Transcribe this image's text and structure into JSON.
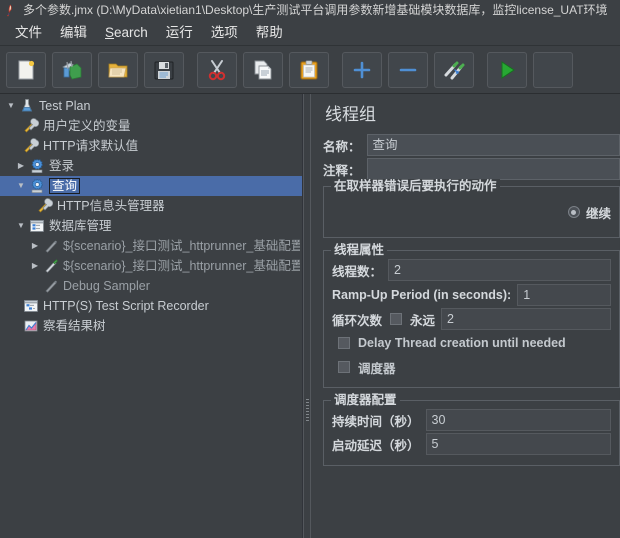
{
  "window": {
    "title": "多个参数.jmx (D:\\MyData\\xietian1\\Desktop\\生产测试平台调用参数新增基础模块数据库，监控license_UAT环境",
    "icon": "jmeter-feather-icon"
  },
  "menubar": {
    "items": [
      {
        "label": "文件",
        "name": "menu-file"
      },
      {
        "label": "编辑",
        "name": "menu-edit"
      },
      {
        "label": "Search",
        "name": "menu-search",
        "mnemonic": "S"
      },
      {
        "label": "运行",
        "name": "menu-run"
      },
      {
        "label": "选项",
        "name": "menu-options"
      },
      {
        "label": "帮助",
        "name": "menu-help"
      }
    ]
  },
  "toolbar": {
    "buttons": [
      {
        "name": "new-button",
        "icon": "new-document-icon",
        "tooltip": "新建"
      },
      {
        "name": "templates-button",
        "icon": "templates-icon",
        "tooltip": "模板"
      },
      {
        "name": "open-button",
        "icon": "open-folder-icon",
        "tooltip": "打开"
      },
      {
        "name": "save-button",
        "icon": "save-disk-icon",
        "tooltip": "保存"
      },
      {
        "name": "cut-button",
        "icon": "scissors-icon",
        "tooltip": "剪切"
      },
      {
        "name": "copy-button",
        "icon": "copy-icon",
        "tooltip": "复制"
      },
      {
        "name": "paste-button",
        "icon": "clipboard-paste-icon",
        "tooltip": "粘贴"
      },
      {
        "name": "expand-all-button",
        "icon": "plus-icon",
        "tooltip": "展开全部"
      },
      {
        "name": "collapse-all-button",
        "icon": "minus-icon",
        "tooltip": "折叠全部"
      },
      {
        "name": "toggle-button",
        "icon": "toggle-pencils-icon",
        "tooltip": "启用/禁用"
      },
      {
        "name": "start-button",
        "icon": "play-green-icon",
        "tooltip": "启动"
      }
    ]
  },
  "tree": {
    "nodes": [
      {
        "name": "tree-node-test-plan",
        "label": "Test Plan",
        "indent": 0,
        "twist": "down",
        "icon": "test-plan-icon",
        "selected": false,
        "dim": false
      },
      {
        "name": "tree-node-user-defined-variables",
        "label": "用户定义的变量",
        "indent": 1,
        "twist": "none",
        "icon": "config-wrench-icon",
        "selected": false,
        "dim": false
      },
      {
        "name": "tree-node-http-request-defaults",
        "label": "HTTP请求默认值",
        "indent": 1,
        "twist": "none",
        "icon": "config-wrench-icon",
        "selected": false,
        "dim": false
      },
      {
        "name": "tree-node-login",
        "label": "登录",
        "indent": 1,
        "twist": "right",
        "icon": "thread-group-gear-icon",
        "selected": false,
        "dim": false
      },
      {
        "name": "tree-node-query",
        "label": "查询",
        "indent": 1,
        "twist": "down",
        "icon": "thread-group-gear-icon",
        "selected": true,
        "dim": false
      },
      {
        "name": "tree-node-http-header-manager",
        "label": "HTTP信息头管理器",
        "indent": 2,
        "twist": "none",
        "icon": "config-wrench-icon",
        "selected": false,
        "dim": false
      },
      {
        "name": "tree-node-database-management",
        "label": "数据库管理",
        "indent": 2,
        "twist": "down",
        "icon": "controller-window-icon",
        "selected": false,
        "dim": false
      },
      {
        "name": "tree-node-scenario-sampler-1",
        "label": "${scenario}_接口测试_httprunner_基础配置.",
        "indent": 3,
        "twist": "right",
        "icon": "sampler-pencil-gray-icon",
        "selected": false,
        "dim": true
      },
      {
        "name": "tree-node-scenario-sampler-2",
        "label": "${scenario}_接口测试_httprunner_基础配置.",
        "indent": 3,
        "twist": "right",
        "icon": "sampler-pencil-green-icon",
        "selected": false,
        "dim": true
      },
      {
        "name": "tree-node-debug-sampler",
        "label": "Debug Sampler",
        "indent": 3,
        "twist": "none",
        "icon": "sampler-pencil-gray-icon",
        "selected": false,
        "dim": true
      },
      {
        "name": "tree-node-http-test-script-recorder",
        "label": "HTTP(S) Test Script Recorder",
        "indent": 1,
        "twist": "none",
        "icon": "recorder-window-icon",
        "selected": false,
        "dim": false
      },
      {
        "name": "tree-node-view-results-tree",
        "label": "察看结果树",
        "indent": 1,
        "twist": "none",
        "icon": "results-tree-chart-icon",
        "selected": false,
        "dim": false
      }
    ]
  },
  "detail": {
    "panel_title": "线程组",
    "name_label": "名称：",
    "name_value": "查询",
    "comment_label": "注释：",
    "comment_value": "",
    "error_action": {
      "group_title": "在取样器错误后要执行的动作",
      "selected": "继续",
      "options": [
        "继续"
      ]
    },
    "thread_properties": {
      "group_title": "线程属性",
      "threads_label": "线程数：",
      "threads_value": "2",
      "ramp_up_label": "Ramp-Up Period (in seconds):",
      "ramp_up_value": "1",
      "loop_label": "循环次数",
      "forever_label": "永远",
      "forever_checked": false,
      "loop_value": "2",
      "delay_thread_label": "Delay Thread creation until needed",
      "delay_thread_checked": false,
      "scheduler_label": "调度器",
      "scheduler_checked": false
    },
    "scheduler_config": {
      "group_title": "调度器配置",
      "duration_label": "持续时间（秒）",
      "duration_value": "30",
      "startup_delay_label": "启动延迟（秒）",
      "startup_delay_value": "5"
    }
  },
  "colors": {
    "background": "#3c4044",
    "selection": "#4a6ca8",
    "text": "#c8cdd2",
    "border": "#5a5f65"
  }
}
